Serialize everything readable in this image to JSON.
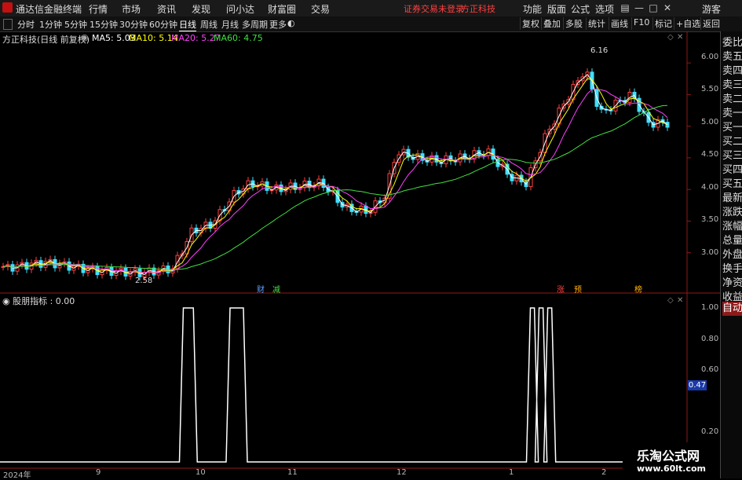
{
  "menubar": {
    "app_name": "通达信金融终端",
    "menus": [
      "行情",
      "市场",
      "资讯",
      "发现",
      "问小达",
      "财富圈",
      "交易"
    ],
    "notice": "证券交易未登录",
    "broker": "方正科技",
    "right_menus": [
      "功能",
      "版面",
      "公式",
      "选项"
    ],
    "guest": "游客",
    "controls": [
      "▤",
      "—",
      "□",
      "✕"
    ]
  },
  "toolbar": {
    "tabs": [
      "分时",
      "1分钟",
      "5分钟",
      "15分钟",
      "30分钟",
      "60分钟",
      "日线",
      "周线",
      "月线",
      "多周期",
      "更多"
    ],
    "active_tab": "日线",
    "right_buttons": [
      "复权",
      "叠加",
      "多股",
      "统计",
      "画线",
      "F10",
      "标记",
      "+自选",
      "返回"
    ]
  },
  "info": {
    "stock": "方正科技(日线 前复权)",
    "ma5_label": "MA5: 5.03",
    "ma10_label": "MA10: 5.14",
    "ma20_label": "MA20: 5.27",
    "ma60_label": "MA60: 4.75",
    "colors": {
      "ma5": "#ffffff",
      "ma10": "#ffff00",
      "ma20": "#ff40ff",
      "ma60": "#40e040"
    }
  },
  "price_axis": [
    "6.00",
    "5.50",
    "5.00",
    "4.50",
    "4.00",
    "3.50",
    "3.00"
  ],
  "annotations": {
    "high": "6.16",
    "low": "2.58"
  },
  "event_markers": [
    "财",
    "减",
    "涨",
    "预",
    "榜"
  ],
  "indicator": {
    "name": "股朋指标",
    "value": ": 0.00",
    "axis": [
      "1.00",
      "0.80",
      "0.60",
      "0.47",
      "0.20"
    ],
    "current_badge": "0.47"
  },
  "date_axis": [
    "2024年",
    "9",
    "10",
    "11",
    "12",
    "1",
    "2"
  ],
  "right_panel": [
    "委比",
    "卖五",
    "卖四",
    "卖三",
    "卖二",
    "卖一",
    "买一",
    "买二",
    "买三",
    "买四",
    "买五",
    "最新",
    "涨跌",
    "涨幅",
    "总量",
    "外盘",
    "换手",
    "净资",
    "收益",
    "自动"
  ],
  "watermark": {
    "line1": "乐淘公式网",
    "line2": "www.60lt.com"
  },
  "chart_data": {
    "type": "line",
    "title": "",
    "series": [
      {
        "name": "MA5",
        "approx_last": 5.03
      },
      {
        "name": "MA10",
        "approx_last": 5.14
      },
      {
        "name": "MA20",
        "approx_last": 5.27
      },
      {
        "name": "MA60",
        "approx_last": 4.75
      }
    ],
    "ylim": [
      2.4,
      6.3
    ],
    "indicator_series": {
      "name": "股朋指标",
      "ylim": [
        0,
        1
      ],
      "pulses": [
        {
          "start": 0.27,
          "end": 0.285
        },
        {
          "start": 0.34,
          "end": 0.36
        },
        {
          "start": 0.79,
          "end": 0.796
        },
        {
          "start": 0.803,
          "end": 0.809
        },
        {
          "start": 0.816,
          "end": 0.822
        }
      ]
    }
  }
}
